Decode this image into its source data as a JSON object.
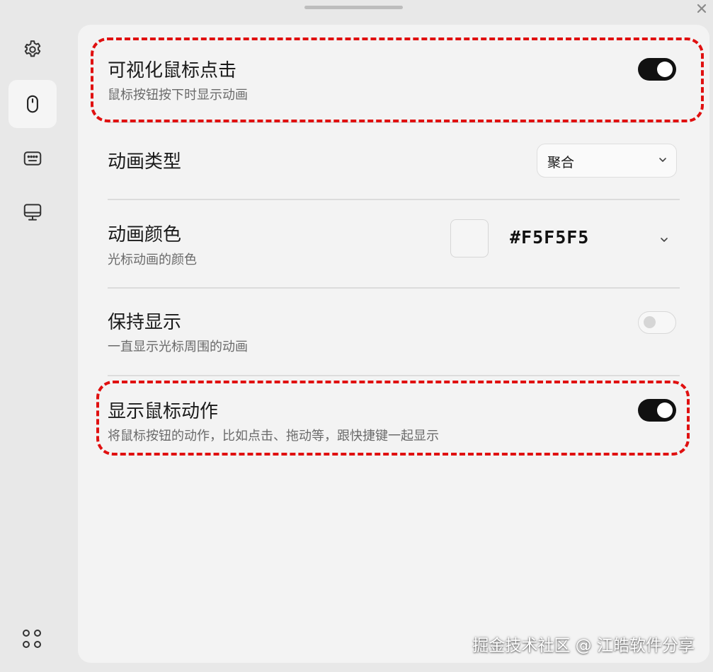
{
  "sidebar": {
    "items": [
      {
        "icon": "gear-icon",
        "active": false
      },
      {
        "icon": "mouse-icon",
        "active": true
      },
      {
        "icon": "keyboard-icon",
        "active": false
      },
      {
        "icon": "monitor-icon",
        "active": false
      }
    ],
    "bottom_icon": "apps-grid-icon"
  },
  "settings": {
    "visualize_click": {
      "title": "可视化鼠标点击",
      "description": "鼠标按钮按下时显示动画",
      "enabled": true
    },
    "animation_type": {
      "title": "动画类型",
      "selected": "聚合"
    },
    "animation_color": {
      "title": "动画颜色",
      "description": "光标动画的颜色",
      "value": "#F5F5F5"
    },
    "keep_showing": {
      "title": "保持显示",
      "description": "一直显示光标周围的动画",
      "enabled": false
    },
    "show_mouse_action": {
      "title": "显示鼠标动作",
      "description": "将鼠标按钮的动作，比如点击、拖动等，跟快捷键一起显示",
      "enabled": true
    }
  },
  "watermark": "掘金技术社区 @ 江皓软件分享",
  "colors": {
    "highlight": "#E01010",
    "toggle_on": "#111111",
    "panel_bg": "#F3F3F3"
  }
}
